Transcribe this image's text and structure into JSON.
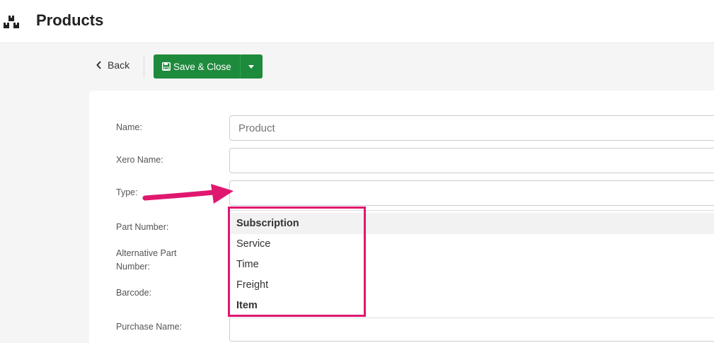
{
  "header": {
    "title": "Products",
    "icon": "boxes-icon"
  },
  "toolbar": {
    "back_label": "Back",
    "save_label": "Save & Close"
  },
  "form": {
    "name": {
      "label": "Name:",
      "placeholder": "Product"
    },
    "xero_name": {
      "label": "Xero Name:"
    },
    "type": {
      "label": "Type:"
    },
    "part_number": {
      "label": "Part Number:"
    },
    "alt_part_number": {
      "label_line1": "Alternative Part",
      "label_line2": "Number:"
    },
    "barcode": {
      "label": "Barcode:"
    },
    "purchase_name": {
      "label": "Purchase Name:"
    }
  },
  "type_dropdown": {
    "options": [
      "Subscription",
      "Service",
      "Time",
      "Freight",
      "Item"
    ]
  },
  "colors": {
    "accent_green": "#1e8a3c",
    "annotation_pink": "#e0176f"
  }
}
